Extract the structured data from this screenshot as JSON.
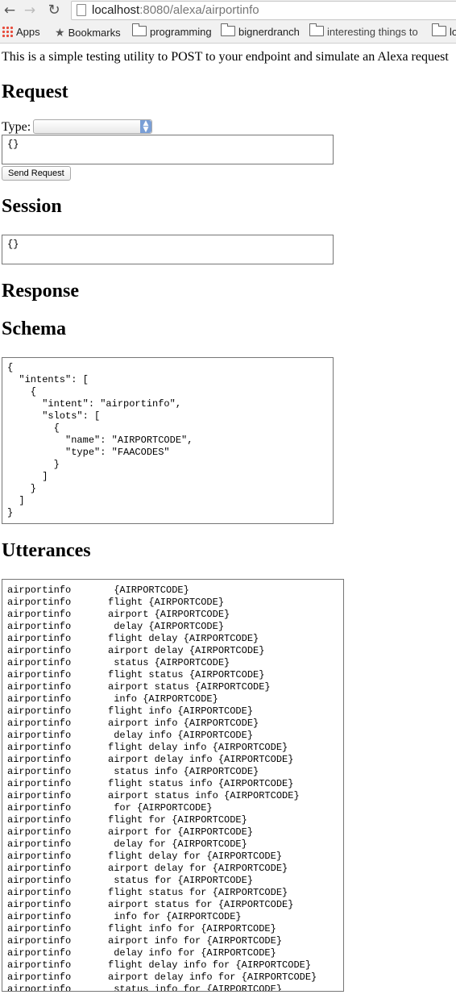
{
  "browser": {
    "url_host": "localhost",
    "url_rest": ":8080/alexa/airportinfo",
    "bookmarks": [
      "Apps",
      "Bookmarks",
      "programming",
      "bignerdranch",
      "interesting things to",
      "lo"
    ]
  },
  "page": {
    "intro": "This is a simple testing utility to POST to your endpoint and simulate an Alexa request",
    "request_heading": "Request",
    "type_label": "Type:",
    "type_value": "",
    "request_body": "{}",
    "send_button": "Send Request",
    "session_heading": "Session",
    "session_body": "{}",
    "response_heading": "Response",
    "schema_heading": "Schema",
    "schema_text": "{\n  \"intents\": [\n    {\n      \"intent\": \"airportinfo\",\n      \"slots\": [\n        {\n          \"name\": \"AIRPORTCODE\",\n          \"type\": \"FAACODES\"\n        }\n      ]\n    }\n  ]\n}",
    "utterances_heading": "Utterances",
    "utterances": [
      {
        "intent": "airportinfo",
        "phrase": " {AIRPORTCODE}"
      },
      {
        "intent": "airportinfo",
        "phrase": "flight {AIRPORTCODE}"
      },
      {
        "intent": "airportinfo",
        "phrase": "airport {AIRPORTCODE}"
      },
      {
        "intent": "airportinfo",
        "phrase": " delay {AIRPORTCODE}"
      },
      {
        "intent": "airportinfo",
        "phrase": "flight delay {AIRPORTCODE}"
      },
      {
        "intent": "airportinfo",
        "phrase": "airport delay {AIRPORTCODE}"
      },
      {
        "intent": "airportinfo",
        "phrase": " status {AIRPORTCODE}"
      },
      {
        "intent": "airportinfo",
        "phrase": "flight status {AIRPORTCODE}"
      },
      {
        "intent": "airportinfo",
        "phrase": "airport status {AIRPORTCODE}"
      },
      {
        "intent": "airportinfo",
        "phrase": " info {AIRPORTCODE}"
      },
      {
        "intent": "airportinfo",
        "phrase": "flight info {AIRPORTCODE}"
      },
      {
        "intent": "airportinfo",
        "phrase": "airport info {AIRPORTCODE}"
      },
      {
        "intent": "airportinfo",
        "phrase": " delay info {AIRPORTCODE}"
      },
      {
        "intent": "airportinfo",
        "phrase": "flight delay info {AIRPORTCODE}"
      },
      {
        "intent": "airportinfo",
        "phrase": "airport delay info {AIRPORTCODE}"
      },
      {
        "intent": "airportinfo",
        "phrase": " status info {AIRPORTCODE}"
      },
      {
        "intent": "airportinfo",
        "phrase": "flight status info {AIRPORTCODE}"
      },
      {
        "intent": "airportinfo",
        "phrase": "airport status info {AIRPORTCODE}"
      },
      {
        "intent": "airportinfo",
        "phrase": " for {AIRPORTCODE}"
      },
      {
        "intent": "airportinfo",
        "phrase": "flight for {AIRPORTCODE}"
      },
      {
        "intent": "airportinfo",
        "phrase": "airport for {AIRPORTCODE}"
      },
      {
        "intent": "airportinfo",
        "phrase": " delay for {AIRPORTCODE}"
      },
      {
        "intent": "airportinfo",
        "phrase": "flight delay for {AIRPORTCODE}"
      },
      {
        "intent": "airportinfo",
        "phrase": "airport delay for {AIRPORTCODE}"
      },
      {
        "intent": "airportinfo",
        "phrase": " status for {AIRPORTCODE}"
      },
      {
        "intent": "airportinfo",
        "phrase": "flight status for {AIRPORTCODE}"
      },
      {
        "intent": "airportinfo",
        "phrase": "airport status for {AIRPORTCODE}"
      },
      {
        "intent": "airportinfo",
        "phrase": " info for {AIRPORTCODE}"
      },
      {
        "intent": "airportinfo",
        "phrase": "flight info for {AIRPORTCODE}"
      },
      {
        "intent": "airportinfo",
        "phrase": "airport info for {AIRPORTCODE}"
      },
      {
        "intent": "airportinfo",
        "phrase": " delay info for {AIRPORTCODE}"
      },
      {
        "intent": "airportinfo",
        "phrase": "flight delay info for {AIRPORTCODE}"
      },
      {
        "intent": "airportinfo",
        "phrase": "airport delay info for {AIRPORTCODE}"
      },
      {
        "intent": "airportinfo",
        "phrase": " status info for {AIRPORTCODE}"
      }
    ]
  }
}
